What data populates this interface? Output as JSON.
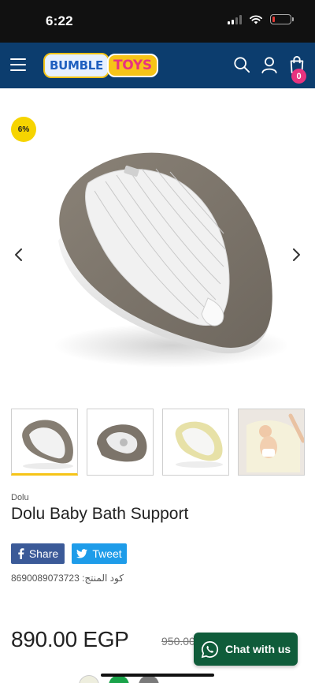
{
  "status_bar": {
    "time": "6:22",
    "battery_level": 0.15,
    "battery_color": "#e53935"
  },
  "header": {
    "logo_left": "BUMBLE",
    "logo_right": "TOYS",
    "menu_icon": "hamburger-menu-icon",
    "search_icon": "search-icon",
    "account_icon": "user-icon",
    "cart_icon": "shopping-bag-icon",
    "cart_count": "0",
    "background_color": "#0c3d6e",
    "badge_color": "#e8337f"
  },
  "product": {
    "discount_badge": "6%",
    "brand": "Dolu",
    "title": "Dolu Baby Bath Support",
    "share_label": "Share",
    "tweet_label": "Tweet",
    "sku": "كود المنتج: 8690089073723",
    "price": "890.00 EGP",
    "old_price": "950.00",
    "thumbnails": [
      {
        "name": "grey bath support",
        "active": true
      },
      {
        "name": "grey bath support angled",
        "active": false
      },
      {
        "name": "yellow bath support",
        "active": false
      },
      {
        "name": "baby in bath support",
        "active": false
      }
    ]
  },
  "chat": {
    "label": "Chat with us",
    "icon": "whatsapp-icon",
    "color": "#0f5c3a"
  }
}
